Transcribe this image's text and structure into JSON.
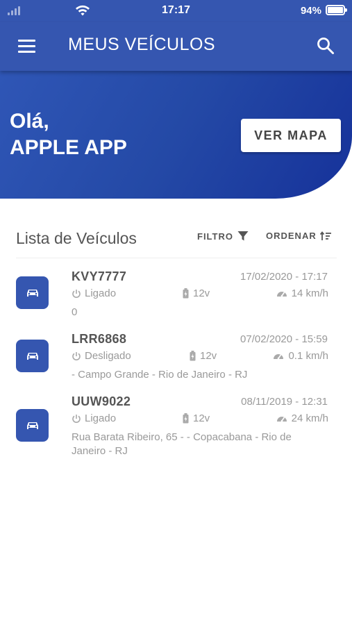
{
  "status_bar": {
    "time": "17:17",
    "battery": "94%",
    "signal_icon": "signal-bars-icon",
    "wifi_icon": "wifi-icon",
    "battery_icon": "battery-icon"
  },
  "app_bar": {
    "title": "MEUS VEÍCULOS",
    "menu_icon": "hamburger-menu-icon",
    "search_icon": "search-icon"
  },
  "hero": {
    "greeting_line1": "Olá,",
    "greeting_line2": "APPLE APP",
    "map_button": "VER MAPA"
  },
  "list": {
    "title": "Lista de Veículos",
    "filter_label": "FILTRO",
    "sort_label": "ORDENAR"
  },
  "vehicles": [
    {
      "plate": "KVY7777",
      "datetime": "17/02/2020 - 17:17",
      "ignition": "Ligado",
      "voltage": "12v",
      "speed": "14 km/h",
      "address": "0"
    },
    {
      "plate": "LRR6868",
      "datetime": "07/02/2020 - 15:59",
      "ignition": "Desligado",
      "voltage": "12v",
      "speed": "0.1 km/h",
      "address": "- Campo Grande - Rio de Janeiro - RJ"
    },
    {
      "plate": "UUW9022",
      "datetime": "08/11/2019 - 12:31",
      "ignition": "Ligado",
      "voltage": "12v",
      "speed": "24 km/h",
      "address": "Rua Barata Ribeiro, 65 - - Copacabana - Rio de Janeiro - RJ"
    }
  ],
  "colors": {
    "primary": "#3556b0",
    "hero_dark": "#16329a",
    "text_muted": "#999999"
  }
}
